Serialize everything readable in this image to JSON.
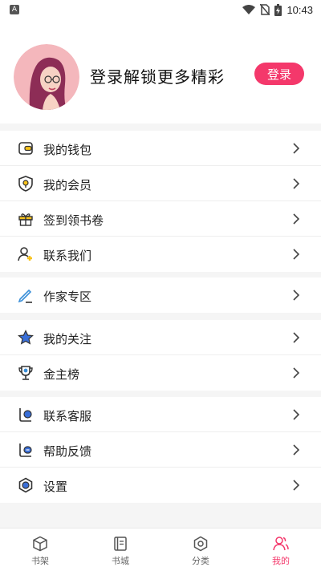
{
  "status_bar": {
    "time": "10:43",
    "app_badge": "A"
  },
  "profile": {
    "prompt": "登录解锁更多精彩",
    "login_button": "登录"
  },
  "menu": {
    "group1": [
      {
        "label": "我的钱包",
        "icon": "wallet-icon"
      },
      {
        "label": "我的会员",
        "icon": "member-shield-icon"
      },
      {
        "label": "签到领书卷",
        "icon": "gift-icon"
      },
      {
        "label": "联系我们",
        "icon": "contact-user-icon"
      }
    ],
    "group2": [
      {
        "label": "作家专区",
        "icon": "pen-icon"
      }
    ],
    "group3": [
      {
        "label": "我的关注",
        "icon": "star-icon"
      },
      {
        "label": "金主榜",
        "icon": "trophy-icon"
      }
    ],
    "group4": [
      {
        "label": "联系客服",
        "icon": "customer-service-icon"
      },
      {
        "label": "帮助反馈",
        "icon": "feedback-icon"
      },
      {
        "label": "设置",
        "icon": "settings-icon"
      }
    ]
  },
  "tabbar": [
    {
      "label": "书架",
      "icon": "bookshelf-icon",
      "active": false
    },
    {
      "label": "书城",
      "icon": "bookstore-icon",
      "active": false
    },
    {
      "label": "分类",
      "icon": "category-icon",
      "active": false
    },
    {
      "label": "我的",
      "icon": "profile-icon",
      "active": true
    }
  ],
  "colors": {
    "accent": "#f4386b",
    "background": "#f5f5f5",
    "icon_yellow": "#f7c21b",
    "icon_blue": "#3a6fd8"
  }
}
